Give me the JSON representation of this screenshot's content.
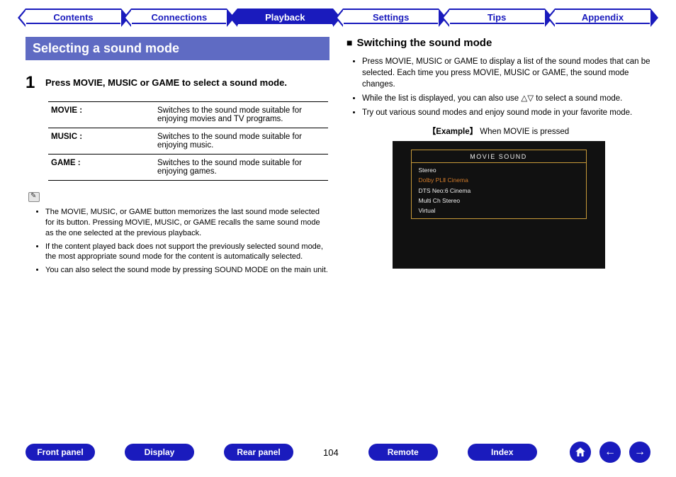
{
  "tabs": [
    "Contents",
    "Connections",
    "Playback",
    "Settings",
    "Tips",
    "Appendix"
  ],
  "active_tab_index": 2,
  "left": {
    "heading": "Selecting a sound mode",
    "step_num": "1",
    "step_text": "Press MOVIE, MUSIC or GAME to select a sound mode.",
    "table": [
      {
        "label": "MOVIE :",
        "desc": "Switches to the sound mode suitable for enjoying movies and TV programs."
      },
      {
        "label": "MUSIC :",
        "desc": "Switches to the sound mode suitable for enjoying music."
      },
      {
        "label": "GAME :",
        "desc": "Switches to the sound mode suitable for enjoying games."
      }
    ],
    "notes": [
      "The MOVIE, MUSIC, or GAME button memorizes the last sound mode selected for its button. Pressing MOVIE, MUSIC, or GAME recalls the same sound mode as the one selected at the previous playback.",
      "If the content played back does not support the previously selected sound mode, the most appropriate sound mode for the content is automatically selected.",
      "You can also select the sound mode by pressing SOUND MODE on the main unit."
    ]
  },
  "right": {
    "heading": "Switching the sound mode",
    "bullets": [
      "Press MOVIE, MUSIC or GAME to display a list of the sound modes that can be selected. Each time you press MOVIE, MUSIC or GAME, the sound mode changes.",
      "While the list is displayed, you can also use △▽ to select a sound mode.",
      "Try out various sound modes and enjoy sound mode in your favorite mode."
    ],
    "example_prefix": "【Example】",
    "example_text": "When MOVIE is pressed",
    "tv_title": "MOVIE SOUND",
    "tv_items": [
      "Stereo",
      "Dolby PLⅡ Cinema",
      "DTS Neo:6 Cinema",
      "Multi Ch Stereo",
      "Virtual"
    ],
    "tv_selected_index": 1
  },
  "bottom": {
    "buttons": [
      "Front panel",
      "Display",
      "Rear panel"
    ],
    "page": "104",
    "buttons2": [
      "Remote",
      "Index"
    ]
  }
}
